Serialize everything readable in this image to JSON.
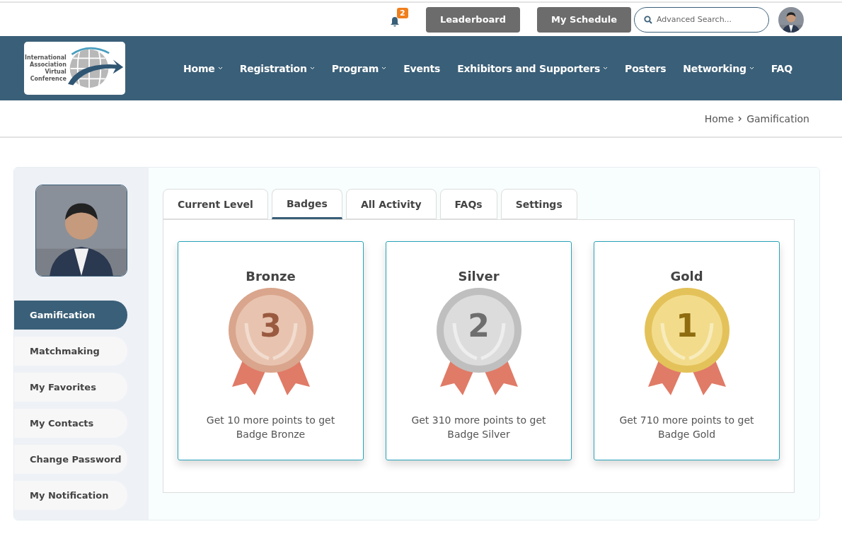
{
  "topbar": {
    "notification_count": "2",
    "buttons": [
      "Leaderboard",
      "My Schedule"
    ],
    "search": {
      "placeholder": "Advanced Search..."
    }
  },
  "logo": {
    "lines": [
      "International",
      "Association",
      "Virtual",
      "Conference"
    ]
  },
  "nav": [
    {
      "label": "Home",
      "dropdown": true
    },
    {
      "label": "Registration",
      "dropdown": true
    },
    {
      "label": "Program",
      "dropdown": true
    },
    {
      "label": "Events",
      "dropdown": false
    },
    {
      "label": "Exhibitors and Supporters",
      "dropdown": true
    },
    {
      "label": "Posters",
      "dropdown": false
    },
    {
      "label": "Networking",
      "dropdown": true
    },
    {
      "label": "FAQ",
      "dropdown": false
    }
  ],
  "breadcrumb": [
    "Home",
    "Gamification"
  ],
  "sidebar": {
    "items": [
      {
        "label": "Gamification",
        "selected": true
      },
      {
        "label": "Matchmaking",
        "selected": false
      },
      {
        "label": "My Favorites",
        "selected": false
      },
      {
        "label": "My Contacts",
        "selected": false
      },
      {
        "label": "Change Password",
        "selected": false
      },
      {
        "label": "My Notification",
        "selected": false
      }
    ]
  },
  "tabs": [
    {
      "label": "Current Level",
      "selected": false
    },
    {
      "label": "Badges",
      "selected": true
    },
    {
      "label": "All Activity",
      "selected": false
    },
    {
      "label": "FAQs",
      "selected": false
    },
    {
      "label": "Settings",
      "selected": false
    }
  ],
  "badges": [
    {
      "title": "Bronze",
      "numeral": "3",
      "kind": "bronze",
      "text": "Get 10 more points to get Badge Bronze"
    },
    {
      "title": "Silver",
      "numeral": "2",
      "kind": "silver",
      "text": "Get 310 more points to get Badge Silver"
    },
    {
      "title": "Gold",
      "numeral": "1",
      "kind": "gold",
      "text": "Get 710 more points to get Badge Gold"
    }
  ]
}
